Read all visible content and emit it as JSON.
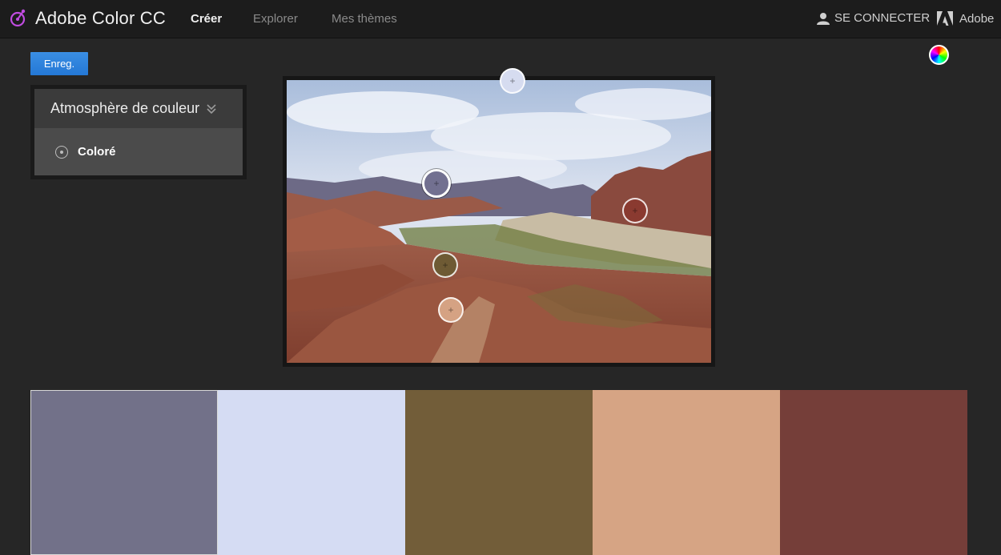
{
  "header": {
    "brand": "Adobe Color CC",
    "logo_icon": "adobe-color-logo-icon",
    "nav": [
      {
        "label": "Créer",
        "active": true
      },
      {
        "label": "Explorer",
        "active": false
      },
      {
        "label": "Mes thèmes",
        "active": false
      }
    ],
    "signin_label": "SE CONNECTER",
    "signin_icon": "user-icon",
    "adobe_label": "Adobe",
    "adobe_icon": "adobe-logo-icon"
  },
  "toolbar": {
    "save_label": "Enreg.",
    "color_wheel_icon": "color-wheel-icon"
  },
  "mood": {
    "title": "Atmosphère de couleur",
    "expand_icon": "double-chevron-down-icon",
    "selected_option": "Coloré",
    "option_icon": "radio-icon"
  },
  "image": {
    "pickers": [
      {
        "color": "#d6dcf0",
        "active": false
      },
      {
        "color": "#727090",
        "active": true
      },
      {
        "color": "#8a3a30",
        "active": false
      },
      {
        "color": "#6e5a34",
        "active": false
      },
      {
        "color": "#d5a283",
        "active": false
      }
    ],
    "picker_icon": "plus-icon"
  },
  "palette": {
    "colors": [
      "#727189",
      "#d5dcf3",
      "#725d39",
      "#d6a484",
      "#753e39"
    ],
    "selected_index": 0
  }
}
